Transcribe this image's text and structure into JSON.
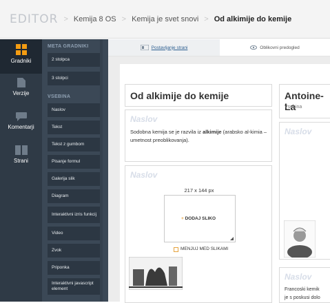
{
  "header": {
    "brand": "EDITOR",
    "breadcrumbs": [
      "Kemija 8 OS",
      "Kemija je svet snovi"
    ],
    "current": "Od alkimije do kemije"
  },
  "rail": {
    "items": [
      {
        "label": "Gradniki",
        "icon": "grid-icon",
        "active": true
      },
      {
        "label": "Verzije",
        "icon": "document-icon",
        "active": false
      },
      {
        "label": "Komentarji",
        "icon": "comment-icon",
        "active": false
      },
      {
        "label": "Strani",
        "icon": "pages-icon",
        "active": false
      }
    ]
  },
  "panel": {
    "meta_heading": "META GRADNIKI",
    "meta_items": [
      "2 stolpca",
      "3 stolpci"
    ],
    "content_heading": "VSEBINA",
    "content_items": [
      "Naslov",
      "Tekst",
      "Tekst z gumbom",
      "Pisanje formul",
      "Galerija slik",
      "Diagram",
      "Interaktivni izris funkcij",
      "Video",
      "Zvok",
      "Priponka",
      "Interaktivni javascript element"
    ]
  },
  "tabs": {
    "layout": "Postavljanje strani",
    "preview": "Oblikovni predogled"
  },
  "page": {
    "left": {
      "title": "Od alkimije do kemije",
      "placeholder1": "Naslov",
      "text_before": "Sodobna kemija se je razvila iz ",
      "text_bold": "alkimije",
      "text_after": " (arabsko al-kimia – umetnost preoblikovanja).",
      "placeholder2": "Naslov",
      "image_size": "217 x 144 px",
      "add_image": "DODAJ SLIKO",
      "checkbox_label": "MENJUJ MED SLIKAMI"
    },
    "right": {
      "title": "Antoine-La",
      "subtitle": "Vsebina",
      "placeholder1": "Naslov",
      "placeholder2": "Naslov",
      "text_line1": "Francoski kemik",
      "text_line2": "je s posk​usi dolo"
    }
  }
}
